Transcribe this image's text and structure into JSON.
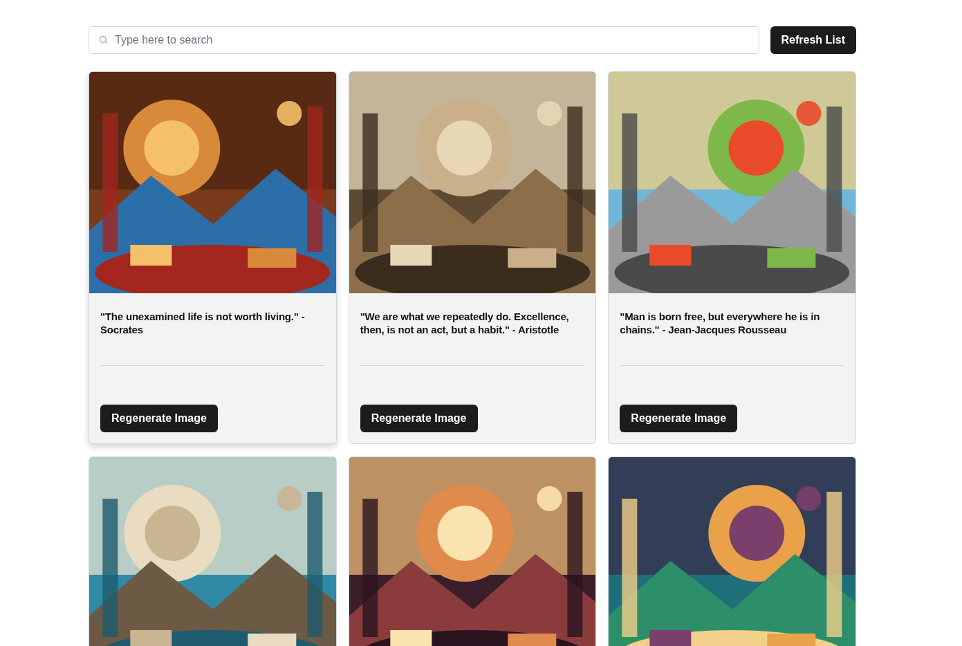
{
  "search": {
    "placeholder": "Type here to search"
  },
  "refresh_button": "Refresh List",
  "cards": [
    {
      "quote": "\"The unexamined life is not worth living.\" - Socrates",
      "button": "Regenerate Image",
      "hovered": true
    },
    {
      "quote": "\"We are what we repeatedly do. Excellence, then, is not an act, but a habit.\" - Aristotle",
      "button": "Regenerate Image",
      "hovered": false
    },
    {
      "quote": "\"Man is born free, but everywhere he is in chains.\" - Jean-Jacques Rousseau",
      "button": "Regenerate Image",
      "hovered": false
    },
    {
      "hovered": false
    },
    {
      "hovered": false
    },
    {
      "hovered": false
    }
  ]
}
